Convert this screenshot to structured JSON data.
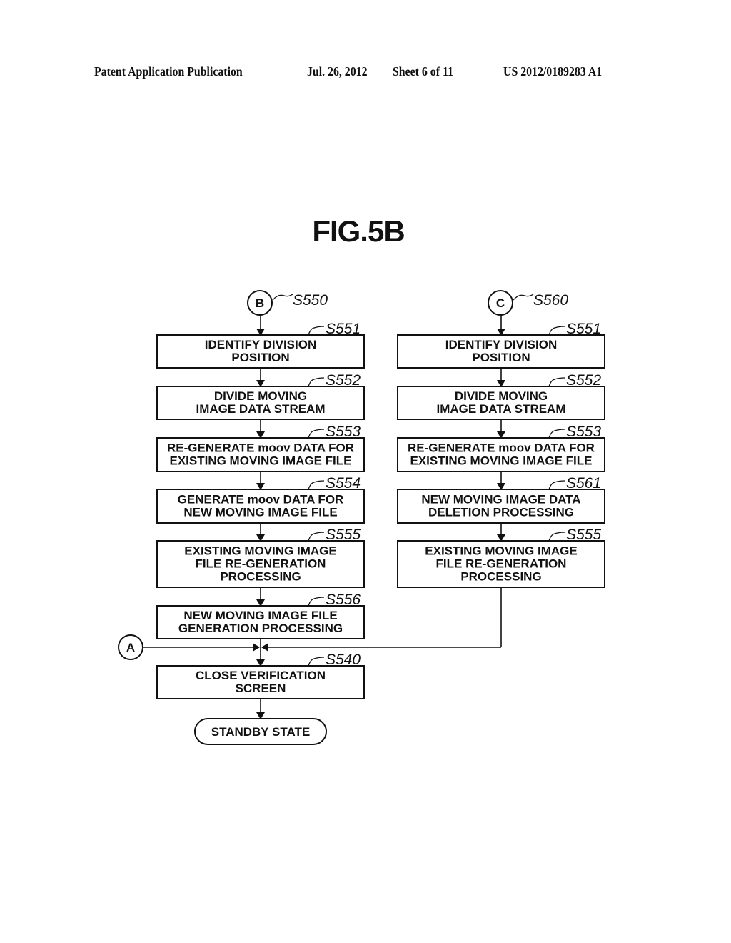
{
  "header": {
    "publication": "Patent Application Publication",
    "date": "Jul. 26, 2012",
    "sheet": "Sheet 6 of 11",
    "patent_number": "US 2012/0189283 A1"
  },
  "figure": {
    "title": "FIG.5B"
  },
  "left_flow": {
    "start_connector": {
      "label": "B",
      "step": "S550"
    },
    "steps": [
      {
        "id": "S551",
        "lines": [
          "IDENTIFY DIVISION",
          "POSITION"
        ]
      },
      {
        "id": "S552",
        "lines": [
          "DIVIDE MOVING",
          "IMAGE DATA STREAM"
        ]
      },
      {
        "id": "S553",
        "lines": [
          "RE-GENERATE moov DATA FOR",
          "EXISTING MOVING IMAGE FILE"
        ]
      },
      {
        "id": "S554",
        "lines": [
          "GENERATE moov DATA FOR",
          "NEW MOVING IMAGE FILE"
        ]
      },
      {
        "id": "S555",
        "lines": [
          "EXISTING MOVING IMAGE",
          "FILE RE-GENERATION",
          "PROCESSING"
        ]
      },
      {
        "id": "S556",
        "lines": [
          "NEW MOVING IMAGE FILE",
          "GENERATION PROCESSING"
        ]
      }
    ]
  },
  "right_flow": {
    "start_connector": {
      "label": "C",
      "step": "S560"
    },
    "steps": [
      {
        "id": "S551",
        "lines": [
          "IDENTIFY DIVISION",
          "POSITION"
        ]
      },
      {
        "id": "S552",
        "lines": [
          "DIVIDE MOVING",
          "IMAGE DATA STREAM"
        ]
      },
      {
        "id": "S553",
        "lines": [
          "RE-GENERATE moov DATA FOR",
          "EXISTING MOVING IMAGE FILE"
        ]
      },
      {
        "id": "S561",
        "lines": [
          "NEW MOVING IMAGE DATA",
          "DELETION PROCESSING"
        ]
      },
      {
        "id": "S555",
        "lines": [
          "EXISTING MOVING IMAGE",
          "FILE RE-GENERATION",
          "PROCESSING"
        ]
      }
    ]
  },
  "merge": {
    "connector_label": "A",
    "final_step": {
      "id": "S540",
      "lines": [
        "CLOSE VERIFICATION",
        "SCREEN"
      ]
    },
    "terminal": "STANDBY STATE"
  }
}
